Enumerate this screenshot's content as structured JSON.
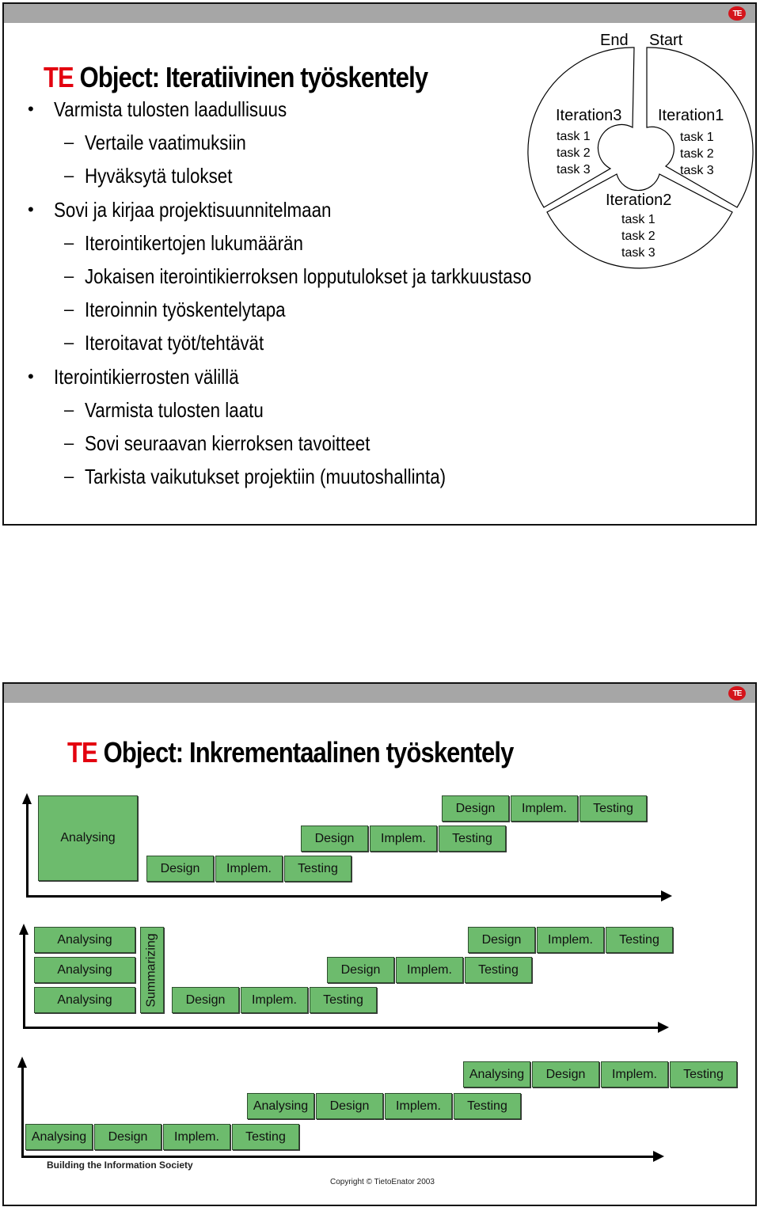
{
  "slide1": {
    "title_prefix": "TE",
    "title_rest": " Object: Iteratiivinen työskentely",
    "bullets": [
      {
        "level": 1,
        "marker": "•",
        "text": "Varmista tulosten laadullisuus"
      },
      {
        "level": 2,
        "marker": "–",
        "text": "Vertaile vaatimuksiin"
      },
      {
        "level": 2,
        "marker": "–",
        "text": "Hyväksytä tulokset"
      },
      {
        "level": 1,
        "marker": "•",
        "text": "Sovi ja kirjaa projektisuunnitelmaan"
      },
      {
        "level": 2,
        "marker": "–",
        "text": "Iterointikertojen lukumäärän"
      },
      {
        "level": 2,
        "marker": "–",
        "text": "Jokaisen iterointikierroksen lopputulokset ja tarkkuustaso"
      },
      {
        "level": 2,
        "marker": "–",
        "text": "Iteroinnin työskentelytapa"
      },
      {
        "level": 2,
        "marker": "–",
        "text": "Iteroitavat työt/tehtävät"
      },
      {
        "level": 1,
        "marker": "•",
        "text": "Iterointikierrosten välillä"
      },
      {
        "level": 2,
        "marker": "–",
        "text": "Varmista tulosten laatu"
      },
      {
        "level": 2,
        "marker": "–",
        "text": "Sovi seuraavan kierroksen tavoitteet"
      },
      {
        "level": 2,
        "marker": "–",
        "text": "Tarkista vaikutukset projektiin (muutoshallinta)"
      }
    ],
    "cycle": {
      "end_label": "End",
      "start_label": "Start",
      "iterations": [
        {
          "name": "Iteration1",
          "tasks": [
            "task 1",
            "task 2",
            "task 3"
          ]
        },
        {
          "name": "Iteration2",
          "tasks": [
            "task 1",
            "task 2",
            "task 3"
          ]
        },
        {
          "name": "Iteration3",
          "tasks": [
            "task 1",
            "task 2",
            "task 3"
          ]
        }
      ]
    }
  },
  "slide2": {
    "title_prefix": "TE",
    "title_rest": " Object: Inkrementaalinen työskentely",
    "diagram1": {
      "analysing": "Analysing",
      "rows": [
        [
          "Design",
          "Implem.",
          "Testing"
        ],
        [
          "Design",
          "Implem.",
          "Testing"
        ],
        [
          "Design",
          "Implem.",
          "Testing"
        ]
      ]
    },
    "diagram2": {
      "analysing": [
        "Analysing",
        "Analysing",
        "Analysing"
      ],
      "summarizing": "Summarizing",
      "rows": [
        [
          "Design",
          "Implem.",
          "Testing"
        ],
        [
          "Design",
          "Implem.",
          "Testing"
        ],
        [
          "Design",
          "Implem.",
          "Testing"
        ]
      ]
    },
    "diagram3": {
      "rows": [
        [
          "Analysing",
          "Design",
          "Implem.",
          "Testing"
        ],
        [
          "Analysing",
          "Design",
          "Implem.",
          "Testing"
        ],
        [
          "Analysing",
          "Design",
          "Implem.",
          "Testing"
        ]
      ]
    },
    "footer_tagline": "Building the Information Society",
    "copyright": "Copyright © TietoEnator 2003"
  },
  "logo_text": "TE",
  "colors": {
    "accent_red": "#e3000f",
    "box_green": "#6dbb6d",
    "header_gray": "#a6a6a6"
  }
}
